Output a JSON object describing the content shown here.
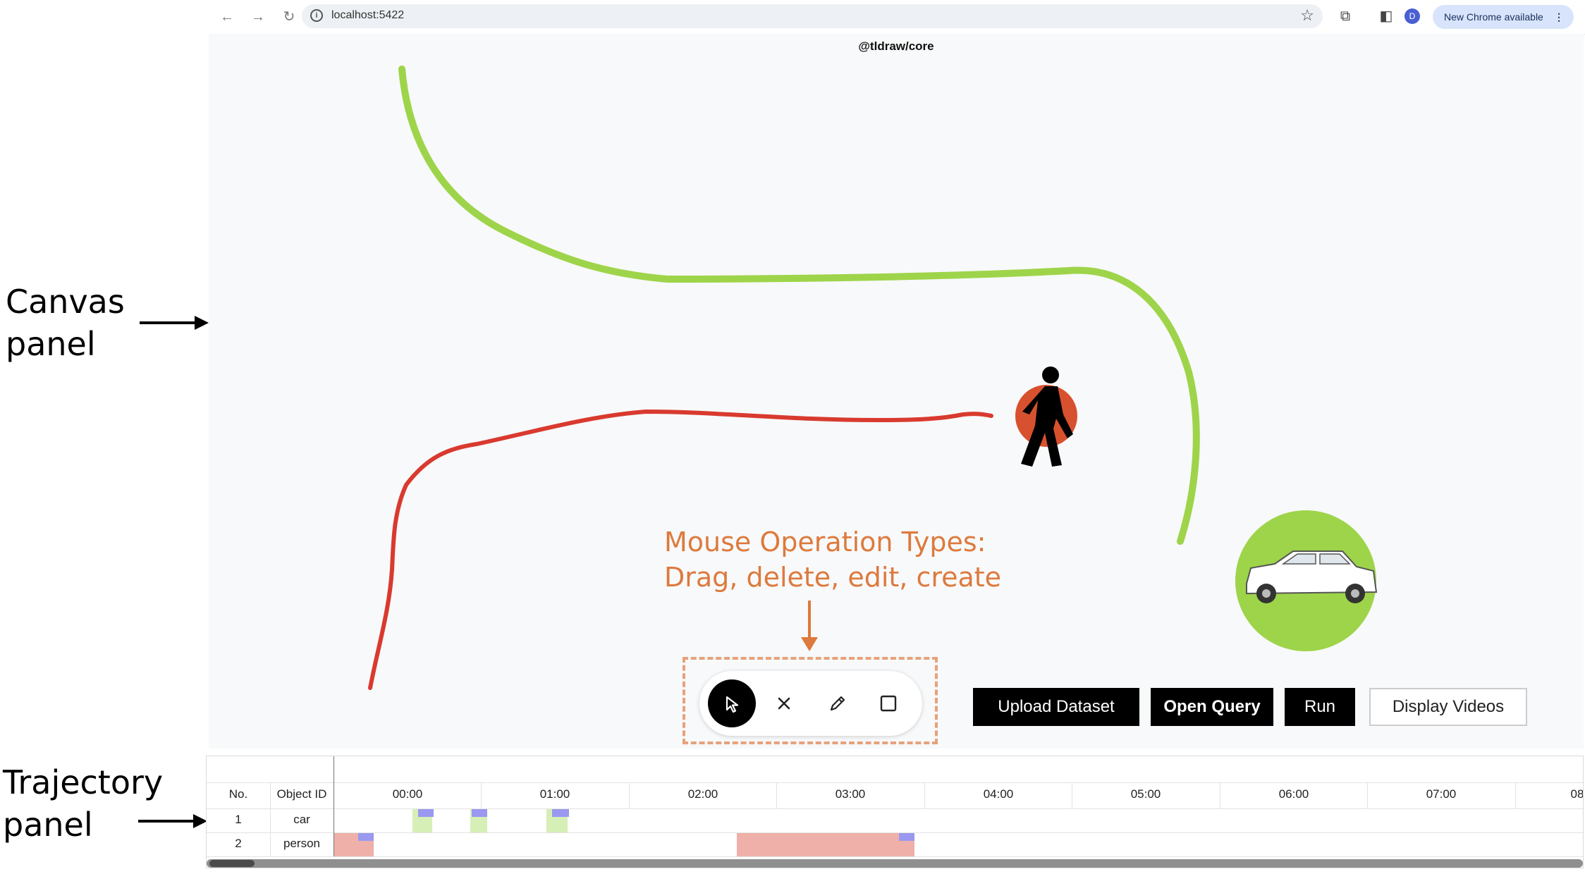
{
  "annotations": {
    "canvas_panel": "Canvas\npanel",
    "trajectory_panel": "Trajectory\npanel",
    "mouse_ops": "Mouse Operation Types:\nDrag, delete, edit, create"
  },
  "browser": {
    "url": "localhost:5422",
    "profile_initial": "D",
    "update_label": "New Chrome available"
  },
  "canvas": {
    "title": "@tldraw/core",
    "colors": {
      "green_path": "#9ed44a",
      "red_path": "#d93a2f",
      "car_circle": "#9ed44a",
      "person_circle": "#d8512e"
    }
  },
  "toolbar": {
    "tools": [
      {
        "name": "select",
        "icon": "cursor-arrow-icon",
        "active": true
      },
      {
        "name": "delete",
        "icon": "close-x-icon",
        "active": false
      },
      {
        "name": "edit",
        "icon": "pencil-icon",
        "active": false
      },
      {
        "name": "create",
        "icon": "square-icon",
        "active": false
      }
    ]
  },
  "buttons": {
    "upload": "Upload Dataset",
    "open_query": "Open Query",
    "run": "Run",
    "display_videos": "Display Videos"
  },
  "trajectory": {
    "columns": {
      "no": "No.",
      "object_id": "Object ID"
    },
    "ticks": [
      "00:00",
      "01:00",
      "02:00",
      "03:00",
      "04:00",
      "05:00",
      "06:00",
      "07:00",
      "08"
    ],
    "rows": [
      {
        "no": "1",
        "object_id": "car"
      },
      {
        "no": "2",
        "object_id": "person"
      }
    ],
    "colors": {
      "car": "#d6efb6",
      "person": "#eeb0a8",
      "marker": "#9a98f0"
    }
  }
}
